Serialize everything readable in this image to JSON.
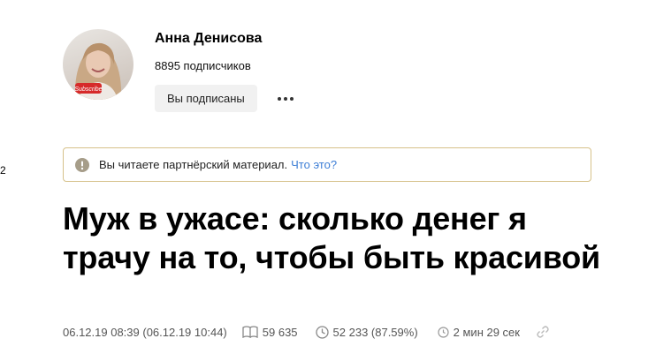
{
  "side": {
    "number": "2"
  },
  "author": {
    "name": "Анна Денисова",
    "subscribers": "8895 подписчиков",
    "subscribed_label": "Вы подписаны",
    "avatar_badge": "Subscribe"
  },
  "notice": {
    "text": "Вы читаете партнёрский материал.",
    "link": "Что это?"
  },
  "article": {
    "title": "Муж в ужасе: сколько денег я трачу на то, чтобы быть красивой"
  },
  "meta": {
    "date": "06.12.19 08:39 (06.12.19 10:44)",
    "views": "59 635",
    "reads": "52 233 (87.59%)",
    "read_time": "2 мин 29 сек"
  },
  "colors": {
    "notice_border": "#d6c189",
    "notice_icon": "#a69d89",
    "link": "#3d7ed6",
    "button_bg": "#f1f1f1"
  },
  "icons": [
    "info-icon",
    "more-icon",
    "book-icon",
    "clock-icon",
    "timer-icon",
    "link-icon"
  ]
}
